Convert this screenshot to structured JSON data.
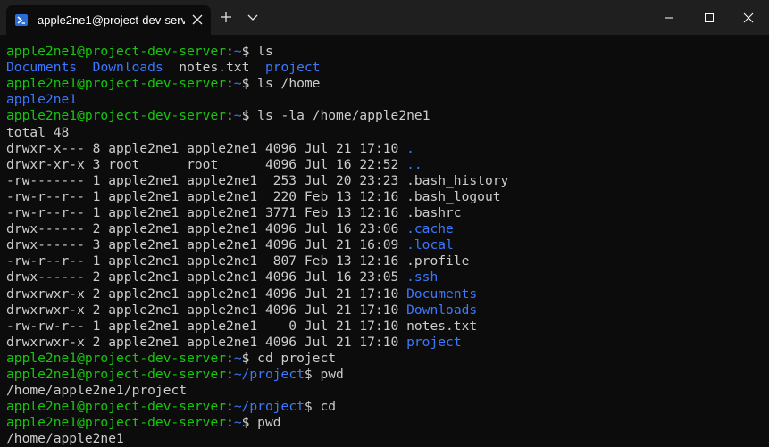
{
  "window": {
    "tab_title": "apple2ne1@project-dev-serve",
    "colors": {
      "titlebar": "#1f1f1f",
      "background": "#0c0c0c",
      "prompt_green": "#16c60c",
      "dir_blue": "#3b78ff",
      "text": "#cccccc"
    },
    "icons": [
      "powershell-icon",
      "close-icon",
      "plus-icon",
      "chevron-down-icon",
      "minimize-icon",
      "maximize-icon",
      "close-window-icon"
    ]
  },
  "lines": [
    [
      {
        "t": "apple2ne1@project-dev-server",
        "c": "g"
      },
      {
        "t": ":",
        "c": "w"
      },
      {
        "t": "~",
        "c": "b"
      },
      {
        "t": "$ ls",
        "c": "w"
      }
    ],
    [
      {
        "t": "Documents",
        "c": "b"
      },
      {
        "t": "  ",
        "c": "w"
      },
      {
        "t": "Downloads",
        "c": "b"
      },
      {
        "t": "  notes.txt  ",
        "c": "w"
      },
      {
        "t": "project",
        "c": "b"
      }
    ],
    [
      {
        "t": "apple2ne1@project-dev-server",
        "c": "g"
      },
      {
        "t": ":",
        "c": "w"
      },
      {
        "t": "~",
        "c": "b"
      },
      {
        "t": "$ ls /home",
        "c": "w"
      }
    ],
    [
      {
        "t": "apple2ne1",
        "c": "b"
      }
    ],
    [
      {
        "t": "apple2ne1@project-dev-server",
        "c": "g"
      },
      {
        "t": ":",
        "c": "w"
      },
      {
        "t": "~",
        "c": "b"
      },
      {
        "t": "$ ls -la /home/apple2ne1",
        "c": "w"
      }
    ],
    [
      {
        "t": "total 48",
        "c": "w"
      }
    ],
    [
      {
        "t": "drwxr-x--- 8 apple2ne1 apple2ne1 4096 Jul 21 17:10 ",
        "c": "w"
      },
      {
        "t": ".",
        "c": "b"
      }
    ],
    [
      {
        "t": "drwxr-xr-x 3 root      root      4096 Jul 16 22:52 ",
        "c": "w"
      },
      {
        "t": "..",
        "c": "b"
      }
    ],
    [
      {
        "t": "-rw------- 1 apple2ne1 apple2ne1  253 Jul 20 23:23 .bash_history",
        "c": "w"
      }
    ],
    [
      {
        "t": "-rw-r--r-- 1 apple2ne1 apple2ne1  220 Feb 13 12:16 .bash_logout",
        "c": "w"
      }
    ],
    [
      {
        "t": "-rw-r--r-- 1 apple2ne1 apple2ne1 3771 Feb 13 12:16 .bashrc",
        "c": "w"
      }
    ],
    [
      {
        "t": "drwx------ 2 apple2ne1 apple2ne1 4096 Jul 16 23:06 ",
        "c": "w"
      },
      {
        "t": ".cache",
        "c": "b"
      }
    ],
    [
      {
        "t": "drwx------ 3 apple2ne1 apple2ne1 4096 Jul 21 16:09 ",
        "c": "w"
      },
      {
        "t": ".local",
        "c": "b"
      }
    ],
    [
      {
        "t": "-rw-r--r-- 1 apple2ne1 apple2ne1  807 Feb 13 12:16 .profile",
        "c": "w"
      }
    ],
    [
      {
        "t": "drwx------ 2 apple2ne1 apple2ne1 4096 Jul 16 23:05 ",
        "c": "w"
      },
      {
        "t": ".ssh",
        "c": "b"
      }
    ],
    [
      {
        "t": "drwxrwxr-x 2 apple2ne1 apple2ne1 4096 Jul 21 17:10 ",
        "c": "w"
      },
      {
        "t": "Documents",
        "c": "b"
      }
    ],
    [
      {
        "t": "drwxrwxr-x 2 apple2ne1 apple2ne1 4096 Jul 21 17:10 ",
        "c": "w"
      },
      {
        "t": "Downloads",
        "c": "b"
      }
    ],
    [
      {
        "t": "-rw-rw-r-- 1 apple2ne1 apple2ne1    0 Jul 21 17:10 notes.txt",
        "c": "w"
      }
    ],
    [
      {
        "t": "drwxrwxr-x 2 apple2ne1 apple2ne1 4096 Jul 21 17:10 ",
        "c": "w"
      },
      {
        "t": "project",
        "c": "b"
      }
    ],
    [
      {
        "t": "apple2ne1@project-dev-server",
        "c": "g"
      },
      {
        "t": ":",
        "c": "w"
      },
      {
        "t": "~",
        "c": "b"
      },
      {
        "t": "$ cd project",
        "c": "w"
      }
    ],
    [
      {
        "t": "apple2ne1@project-dev-server",
        "c": "g"
      },
      {
        "t": ":",
        "c": "w"
      },
      {
        "t": "~/project",
        "c": "b"
      },
      {
        "t": "$ pwd",
        "c": "w"
      }
    ],
    [
      {
        "t": "/home/apple2ne1/project",
        "c": "w"
      }
    ],
    [
      {
        "t": "apple2ne1@project-dev-server",
        "c": "g"
      },
      {
        "t": ":",
        "c": "w"
      },
      {
        "t": "~/project",
        "c": "b"
      },
      {
        "t": "$ cd",
        "c": "w"
      }
    ],
    [
      {
        "t": "apple2ne1@project-dev-server",
        "c": "g"
      },
      {
        "t": ":",
        "c": "w"
      },
      {
        "t": "~",
        "c": "b"
      },
      {
        "t": "$ pwd",
        "c": "w"
      }
    ],
    [
      {
        "t": "/home/apple2ne1",
        "c": "w"
      }
    ]
  ]
}
